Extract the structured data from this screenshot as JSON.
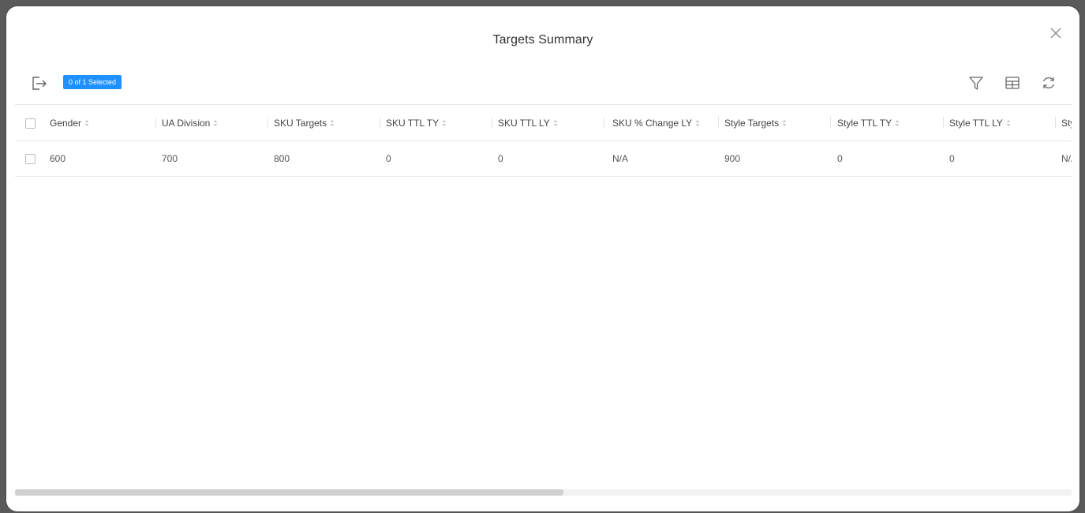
{
  "dialog": {
    "title": "Targets Summary"
  },
  "toolbar": {
    "selection_badge": "0 of 1 Selected",
    "icons": [
      "export-icon",
      "filter-icon",
      "columns-icon",
      "refresh-icon"
    ]
  },
  "table": {
    "columns": [
      "Gender",
      "UA Division",
      "SKU Targets",
      "SKU TTL TY",
      "SKU TTL LY",
      "SKU % Change LY",
      "Style Targets",
      "Style TTL TY",
      "Style TTL LY",
      "Styl"
    ],
    "rows": [
      [
        "600",
        "700",
        "800",
        "0",
        "0",
        "N/A",
        "900",
        "0",
        "0",
        "N/A"
      ]
    ]
  },
  "colors": {
    "accent": "#1e90ff",
    "backdrop": "#5a5a5a"
  }
}
